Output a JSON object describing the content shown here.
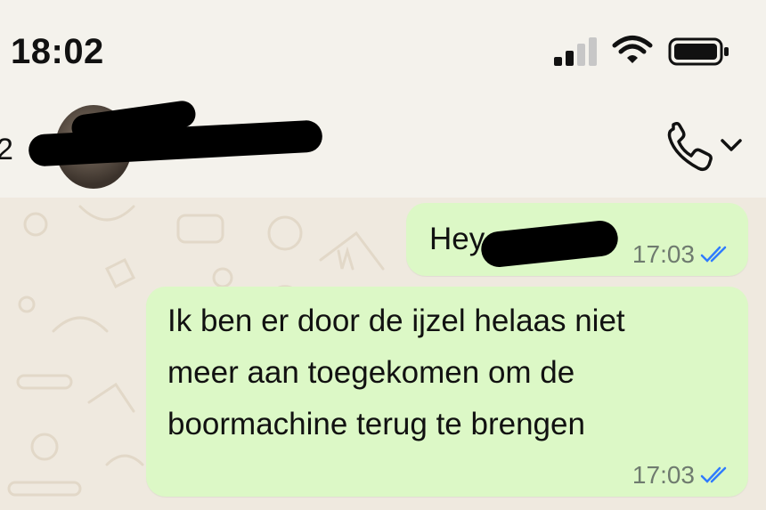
{
  "status_bar": {
    "time": "18:02",
    "icons": [
      "cellular-signal-icon",
      "wifi-icon",
      "battery-icon"
    ]
  },
  "header": {
    "back_fragment": "2",
    "contact_name": "[redacted]",
    "icons": [
      "avatar",
      "phone-icon",
      "chevron-down-icon"
    ]
  },
  "messages": [
    {
      "direction": "outgoing",
      "text": "Hey",
      "time": "17:03",
      "status": "read"
    },
    {
      "direction": "outgoing",
      "text": "Ik ben er door de ijzel helaas niet\nmeer aan toegekomen om de\nboormachine terug te brengen",
      "time": "17:03",
      "status": "read"
    }
  ],
  "colors": {
    "bubble_outgoing": "#dcf8c6",
    "chat_background": "#efe9df",
    "read_ticks": "#2f7bff",
    "header_background": "#f4f2ec"
  }
}
